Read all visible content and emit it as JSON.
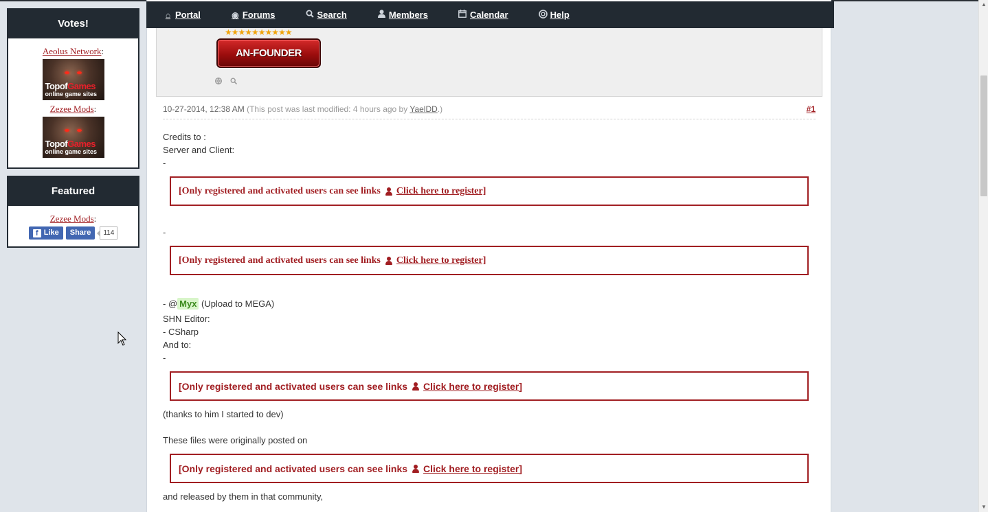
{
  "sidebar": {
    "votes": {
      "title": "Votes!",
      "items": [
        {
          "label": "Aeolus Network"
        },
        {
          "label": "Zezee Mods"
        }
      ],
      "banner": {
        "brand_a": "Topof",
        "brand_b": "Games",
        "tagline": "online game sites"
      }
    },
    "featured": {
      "title": "Featured",
      "link": "Zezee Mods",
      "like": "Like",
      "share": "Share",
      "count": "114"
    }
  },
  "nav": {
    "items": [
      {
        "label": "Portal",
        "icon": "home-icon"
      },
      {
        "label": "Forums",
        "icon": "globe-icon"
      },
      {
        "label": "Search",
        "icon": "search-icon"
      },
      {
        "label": "Members",
        "icon": "user-icon"
      },
      {
        "label": "Calendar",
        "icon": "calendar-icon"
      },
      {
        "label": "Help",
        "icon": "lifebuoy-icon"
      }
    ]
  },
  "post": {
    "rank": "AN-FOUNDER",
    "stars": "★★★★★★★★★★",
    "date": "10-27-2014, 12:38 AM",
    "edit_prefix": "(This post was last modified: 4 hours ago by ",
    "editor": "YaelDD",
    "edit_suffix": ".)",
    "number": "#1",
    "lines": {
      "credits": "Credits to :",
      "server": "Server and Client:",
      "dash1": "-",
      "dash2": "-",
      "mention_prefix": "- @",
      "mention": "Myx",
      "mention_suffix": " (Upload to MEGA)",
      "shn": "SHN Editor:",
      "csharp": "- CSharp",
      "andto": "And to:",
      "dash3": "-",
      "thanks": "(thanks to him I started to dev)",
      "files": "These files were originally posted on",
      "released": " and released by them in that community,"
    },
    "hidden": {
      "text": "[Only registered and activated users can see links",
      "register": "Click here to register]"
    }
  },
  "colors": {
    "accent": "#a11e22",
    "nav_bg": "#222a32"
  }
}
